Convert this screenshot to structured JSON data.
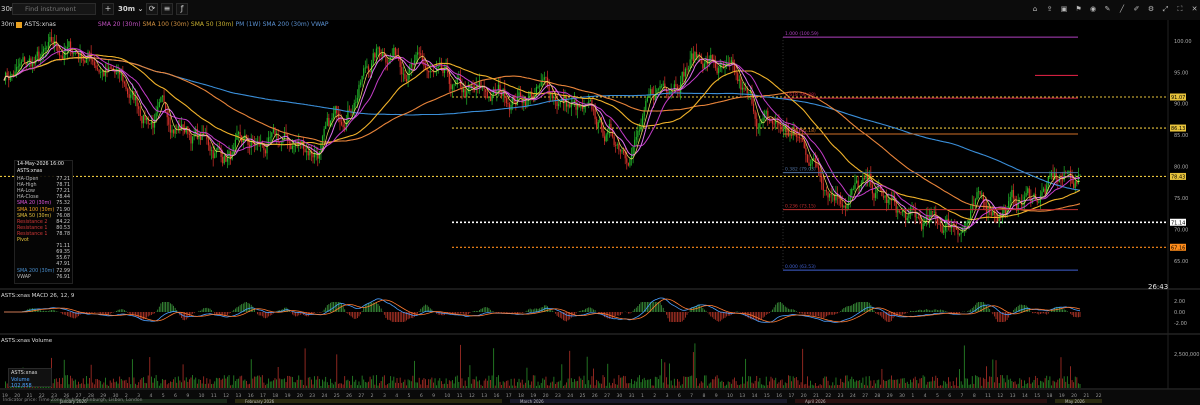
{
  "toolbar": {
    "interval": "30m",
    "search_placeholder": "Find instrument",
    "timeframe": "30m",
    "right_icons": [
      "home-icon",
      "upload-icon",
      "snapshot-icon",
      "alert-icon",
      "eye-icon",
      "pencil-icon",
      "line-icon",
      "draw-icon",
      "settings-icon",
      "maximize-icon",
      "fullscreen-icon",
      "close-icon"
    ]
  },
  "chart_title": {
    "interval": "30m",
    "symbol": "ASTS:xnas",
    "ma_labels": [
      "SMA 20 (30m)",
      "SMA 100 (30m)",
      "SMA 50 (30m)",
      "PM (1W)",
      "SMA 200 (30m)",
      "VWAP"
    ]
  },
  "price_axis": {
    "ticks": [
      "100.00",
      "95.00",
      "90.00",
      "85.00",
      "80.00",
      "75.00",
      "70.00",
      "65.00"
    ],
    "labels": [
      {
        "text": "91.07",
        "color": "#e8c43c"
      },
      {
        "text": "86.13",
        "color": "#e8c43c"
      },
      {
        "text": "78.43",
        "color": "#e8c43c"
      },
      {
        "text": "71.14",
        "color": "#ffffff"
      },
      {
        "text": "67.16",
        "color": "#ff8c1a"
      }
    ],
    "countdown": "26:43"
  },
  "fib_labels": [
    "1.000 (100.59)",
    "0.618 (90.88)",
    "0.500 (85.18)",
    "0.382 (79.03)",
    "0.236 (73.15)",
    "0.000 (63.53)"
  ],
  "info_box": {
    "datetime": "14-May-2026 16:00",
    "symbol": "ASTS:xnas",
    "rows": [
      {
        "k": "HA-Open",
        "v": "77.21",
        "c": "#bbbbbb"
      },
      {
        "k": "HA-High",
        "v": "78.71",
        "c": "#bbbbbb"
      },
      {
        "k": "HA-Low",
        "v": "77.21",
        "c": "#bbbbbb"
      },
      {
        "k": "HA-Close",
        "v": "78.44",
        "c": "#bbbbbb"
      },
      {
        "k": "SMA 20 (30m)",
        "v": "75.32",
        "c": "#e056e0"
      },
      {
        "k": "SMA 100 (30m)",
        "v": "71.90",
        "c": "#f0a020"
      },
      {
        "k": "SMA 50 (30m)",
        "v": "76.08",
        "c": "#e8c43c"
      },
      {
        "k": "Resistance 2",
        "v": "84.22",
        "c": "#d03838"
      },
      {
        "k": "Resistance 1",
        "v": "80.53",
        "c": "#d03838"
      },
      {
        "k": "Resistance 1",
        "v": "78.78",
        "c": "#d03838"
      },
      {
        "k": "Pivot",
        "v": "",
        "c": "#e8c43c"
      },
      {
        "k": "",
        "v": "71.11",
        "c": "#bbbbbb"
      },
      {
        "k": "",
        "v": "69.35",
        "c": "#bbbbbb"
      },
      {
        "k": "",
        "v": "55.67",
        "c": "#bbbbbb"
      },
      {
        "k": "",
        "v": "47.91",
        "c": "#bbbbbb"
      },
      {
        "k": "SMA 200 (30m)",
        "v": "72.99",
        "c": "#4a90d0"
      },
      {
        "k": "VWAP",
        "v": "76.91",
        "c": "#bbbbbb"
      }
    ]
  },
  "macd": {
    "label": "ASTS:xnas  MACD 26, 12, 9",
    "ticks": [
      "2.00",
      "0.00",
      "-2.00"
    ]
  },
  "volume": {
    "label": "ASTS:xnas  Volume",
    "tick": "2,500,000",
    "box_symbol": "ASTS:xnas",
    "box_volume": "Volume 102,858"
  },
  "time_axis": {
    "days": [
      "19",
      "20",
      "21",
      "22",
      "23",
      "26",
      "27",
      "28",
      "29",
      "30",
      "2",
      "3",
      "4",
      "5",
      "6",
      "9",
      "10",
      "11",
      "12",
      "13",
      "16",
      "17",
      "18",
      "19",
      "20",
      "23",
      "24",
      "25",
      "26",
      "27",
      "2",
      "3",
      "4",
      "5",
      "6",
      "9",
      "10",
      "11",
      "12",
      "13",
      "16",
      "17",
      "18",
      "19",
      "20",
      "23",
      "24",
      "25",
      "26",
      "27",
      "30",
      "31",
      "1",
      "2",
      "3",
      "6",
      "7",
      "8",
      "9",
      "10",
      "13",
      "14",
      "15",
      "16",
      "17",
      "20",
      "21",
      "22",
      "23",
      "24",
      "27",
      "28",
      "29",
      "30",
      "1",
      "4",
      "5",
      "6",
      "7",
      "8",
      "11",
      "12",
      "13",
      "14",
      "15",
      "18",
      "19",
      "20",
      "21",
      "22"
    ],
    "months": [
      "January 2026",
      "February 2026",
      "March 2026",
      "April 2026",
      "May 2026"
    ],
    "footer": "Indicator price:  Time Zone: Dublin, Edinburgh, Lisbon, London"
  },
  "colors": {
    "up": "#22b82a",
    "down": "#d8322a",
    "sma20": "#e056e0",
    "sma50": "#f0b22a",
    "sma100": "#e8843a",
    "sma200": "#3a8ed8",
    "dotted_yellow": "#e8c43c",
    "dotted_white": "#ffffff",
    "dotted_orange": "#ff8c1a"
  },
  "chart_data": {
    "type": "line",
    "title": "ASTS:xnas",
    "x": [
      "Jan 19",
      "Jan 27",
      "Feb 4",
      "Feb 12",
      "Feb 20",
      "Mar 2",
      "Mar 10",
      "Mar 18",
      "Mar 26",
      "Apr 3",
      "Apr 13",
      "Apr 21",
      "Apr 29",
      "May 7",
      "May 14"
    ],
    "ylim": [
      61,
      103
    ],
    "series": [
      {
        "name": "ASTS:xnas",
        "values": [
          95,
          98,
          88,
          82,
          83,
          99,
          90,
          92,
          84,
          98,
          86,
          77,
          70,
          74,
          78
        ]
      }
    ],
    "horizontal_levels": [
      91.07,
      86.13,
      78.43,
      71.14,
      67.16
    ],
    "fibonacci": [
      100.59,
      90.88,
      85.18,
      79.03,
      73.15,
      63.53
    ]
  }
}
